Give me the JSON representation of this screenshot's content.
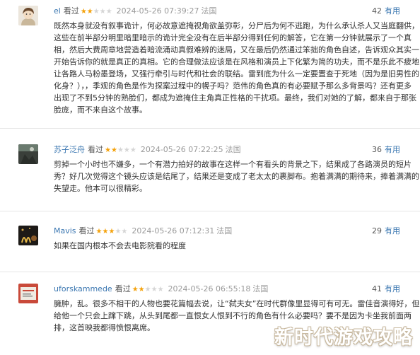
{
  "reviews": [
    {
      "user": "el",
      "rated": "看过",
      "stars": 2,
      "date": "2024-05-26 07:39:27",
      "location": "法国",
      "votes": "42",
      "useful": "有用",
      "lines": [
        "既然本身就没有叙事诡计，何必故意遮掩视角欲盖弥彰，分尸后为何不逃跑，为什么承认杀人又当庭翻供，",
        "这些在前半部分明里暗里暗示的诡计完全没有在后半部分得到任何的解答，它在第一分钟就展示了一个真",
        "相，然后大费周章地营造着暗流涌动真假难辨的迷局，又在最后仍然通过笨拙的角色自述，告诉观众其实一",
        "开始告诉你的就是真正的真相。它的合理做法应该是在风格和演员上下化繁为简的功夫，而不是乐此不疲地",
        "让各路人马粉墨登场，又强行牵引与时代和社会的联结。雷到底为什么一定要置查于死地（因为是旧男性的",
        "化身？），，季观的角色是作为探案过程中的幌子吗？范伟的角色真的有必要赋予那么多背景吗？还有更多",
        "出现了不到5分钟的熟脸们，都成为遮掩住主角真正性格的干扰项。最终，我们对她的了解，都来自于那张",
        "脸庞，而不来自这个故事。"
      ]
    },
    {
      "user": "苏子泛舟",
      "rated": "看过",
      "stars": 2,
      "date": "2024-05-26 07:22:25",
      "location": "法国",
      "votes": "36",
      "useful": "有用",
      "lines": [
        "剪掉一个小时也不嫌多，一个有潜力拍好的故事在这样一个有看头的背景之下，结果成了各路演员的短片",
        "秀？好几次觉得这个镜头应该是结尾了，结果还是变成了老太太的裹脚布。抱着满满的期待来，捧着满满的",
        "失望走。他本可以很精彩。"
      ]
    },
    {
      "user": "Mavis",
      "rated": "看过",
      "stars": 3,
      "date": "2024-05-26 07:12:31",
      "location": "法国",
      "votes": "29",
      "useful": "有用",
      "lines": [
        "如果在国内根本不会去电影院看的程度"
      ]
    },
    {
      "user": "uforskammede",
      "rated": "看过",
      "stars": 2,
      "date": "2024-05-26 06:55:18",
      "location": "法国",
      "votes": "41",
      "useful": "有用",
      "lines": [
        "臃肿，乱。很多不相干的人物也要花篇幅去说，让“弑夫女”在时代群像里显得可有可无。雷佳音演得好，但",
        "给他一个只会上蹿下跳，从头到尾都一直恨女人恨到不行的角色有什么必要吗？要不是因为卡坐我前面两",
        "排，这首映我都得愤恨离席。"
      ]
    }
  ],
  "watermark": "新时代游戏攻略",
  "colors": {
    "link": "#3b77b1",
    "star_on": "#f4a20c",
    "star_off": "#d5d5d5",
    "meta": "#9a9a9a"
  }
}
